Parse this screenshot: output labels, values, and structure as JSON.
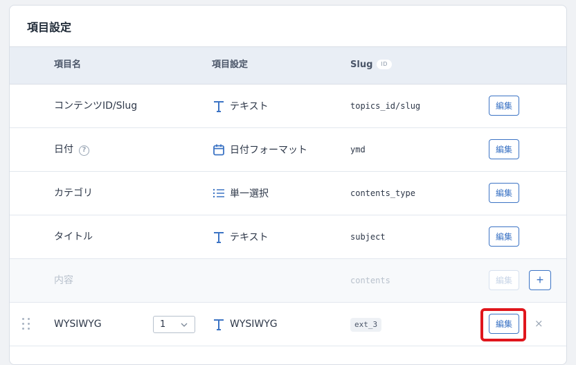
{
  "panel": {
    "title": "項目設定"
  },
  "table": {
    "headers": {
      "name": "項目名",
      "setting": "項目設定",
      "slug": "Slug",
      "slug_badge": "ID"
    },
    "rows": [
      {
        "name": "コンテンツID/Slug",
        "type": "テキスト",
        "type_icon": "text-t-icon",
        "slug": "topics_id/slug",
        "edit": "編集"
      },
      {
        "name": "日付",
        "help": "?",
        "type": "日付フォーマット",
        "type_icon": "calendar-icon",
        "slug": "ymd",
        "edit": "編集"
      },
      {
        "name": "カテゴリ",
        "type": "単一選択",
        "type_icon": "list-icon",
        "slug": "contents_type",
        "edit": "編集"
      },
      {
        "name": "タイトル",
        "type": "テキスト",
        "type_icon": "text-t-icon",
        "slug": "subject",
        "edit": "編集"
      },
      {
        "name": "内容",
        "slug": "contents",
        "edit": "編集",
        "add": "+"
      },
      {
        "name": "WYSIWYG",
        "count": "1",
        "type": "WYSIWYG",
        "type_icon": "text-t-icon",
        "slug": "ext_3",
        "edit": "編集",
        "remove": "×"
      }
    ]
  },
  "colors": {
    "accent": "#3b73c4",
    "highlight": "#e0161c",
    "header_bg": "#e9eef5"
  }
}
